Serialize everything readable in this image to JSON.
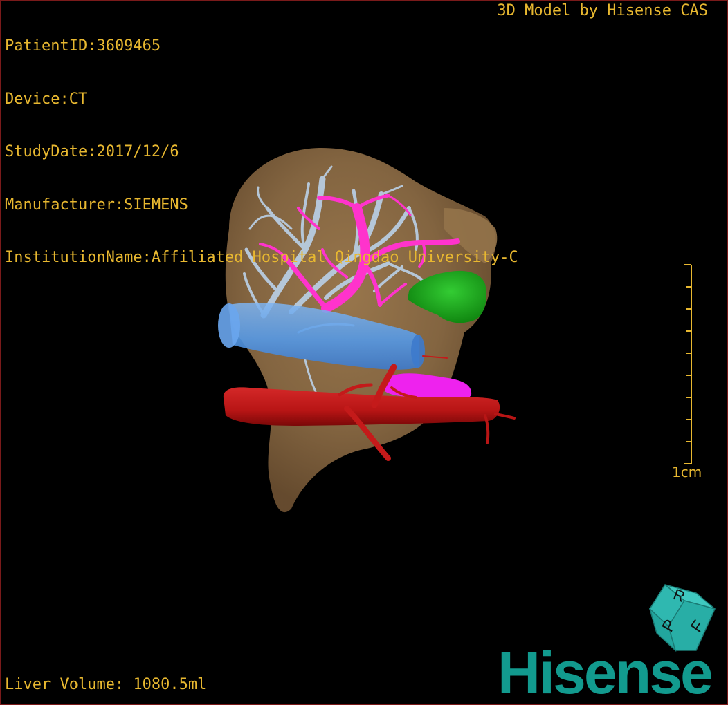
{
  "patient_info": {
    "patient_id": "PatientID:3609465",
    "device": "Device:CT",
    "study_date": "StudyDate:2017/12/6",
    "manufacturer": "Manufacturer:SIEMENS",
    "institution": "InstitutionName:Affiliated Hospital Qingdao University-C"
  },
  "brand_caption": "3D Model by Hisense CAS",
  "liver_volume": "Liver Volume: 1080.5ml",
  "scale_bar": {
    "label": "1cm"
  },
  "orientation_cube": {
    "faces": [
      "P",
      "R",
      "F"
    ]
  },
  "logo_text": "Hisense",
  "colors": {
    "text": "#e8b830",
    "liver": "#8a6a44",
    "hepatic_vein": "#b8cce0",
    "portal_vein": "#ff33cc",
    "vena_cava": "#5599e6",
    "artery": "#c41a1a",
    "tumor": "#22bb22",
    "pancreas": "#ee22ee",
    "brand": "#129a8e"
  }
}
